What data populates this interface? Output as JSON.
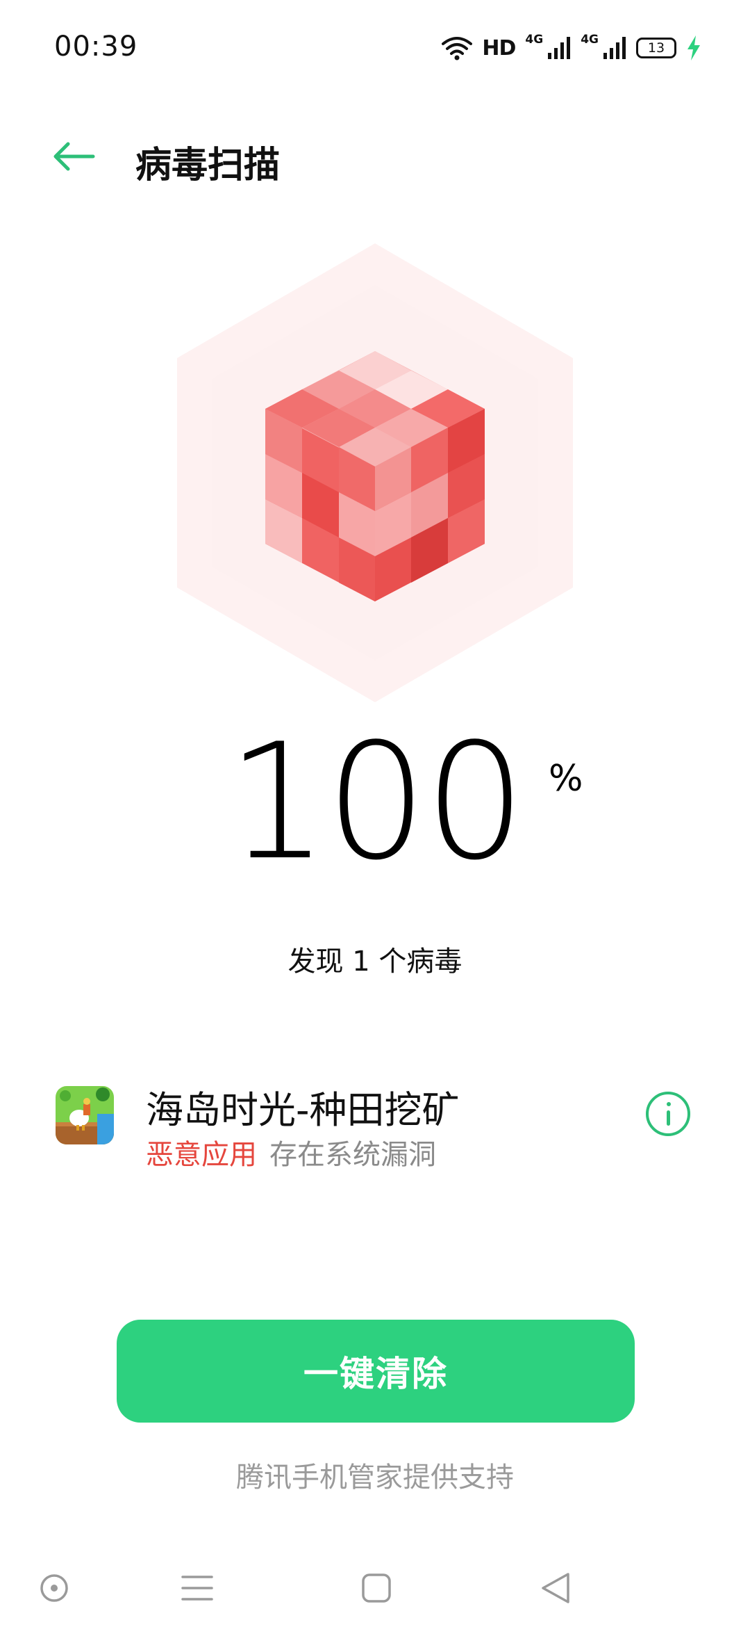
{
  "status_bar": {
    "time": "00:39",
    "network_label_1": "4G",
    "network_label_2": "4G",
    "hd_label": "HD",
    "battery": "13",
    "icons": [
      "wifi-icon",
      "signal-icon",
      "signal-icon",
      "battery-icon",
      "charging-icon"
    ]
  },
  "header": {
    "title": "病毒扫描",
    "back_icon": "back-arrow-icon"
  },
  "scan": {
    "progress": "100",
    "unit": "%",
    "result": "发现 1 个病毒"
  },
  "threats": [
    {
      "app_name": "海岛时光-种田挖矿",
      "type": "恶意应用",
      "description": "存在系统漏洞",
      "icon": "game-app-icon",
      "action_icon": "info-icon"
    }
  ],
  "actions": {
    "clean_label": "一键清除",
    "powered_by": "腾讯手机管家提供支持"
  },
  "colors": {
    "accent": "#2dd17f",
    "accent_dark": "#2dbf78",
    "danger": "#e5463d",
    "cube_red": "#ef5a59",
    "cube_pink": "#f8a7a8"
  },
  "nav_bar": {
    "icons": [
      "assistant-icon",
      "menu-icon",
      "home-icon",
      "back-icon"
    ]
  }
}
